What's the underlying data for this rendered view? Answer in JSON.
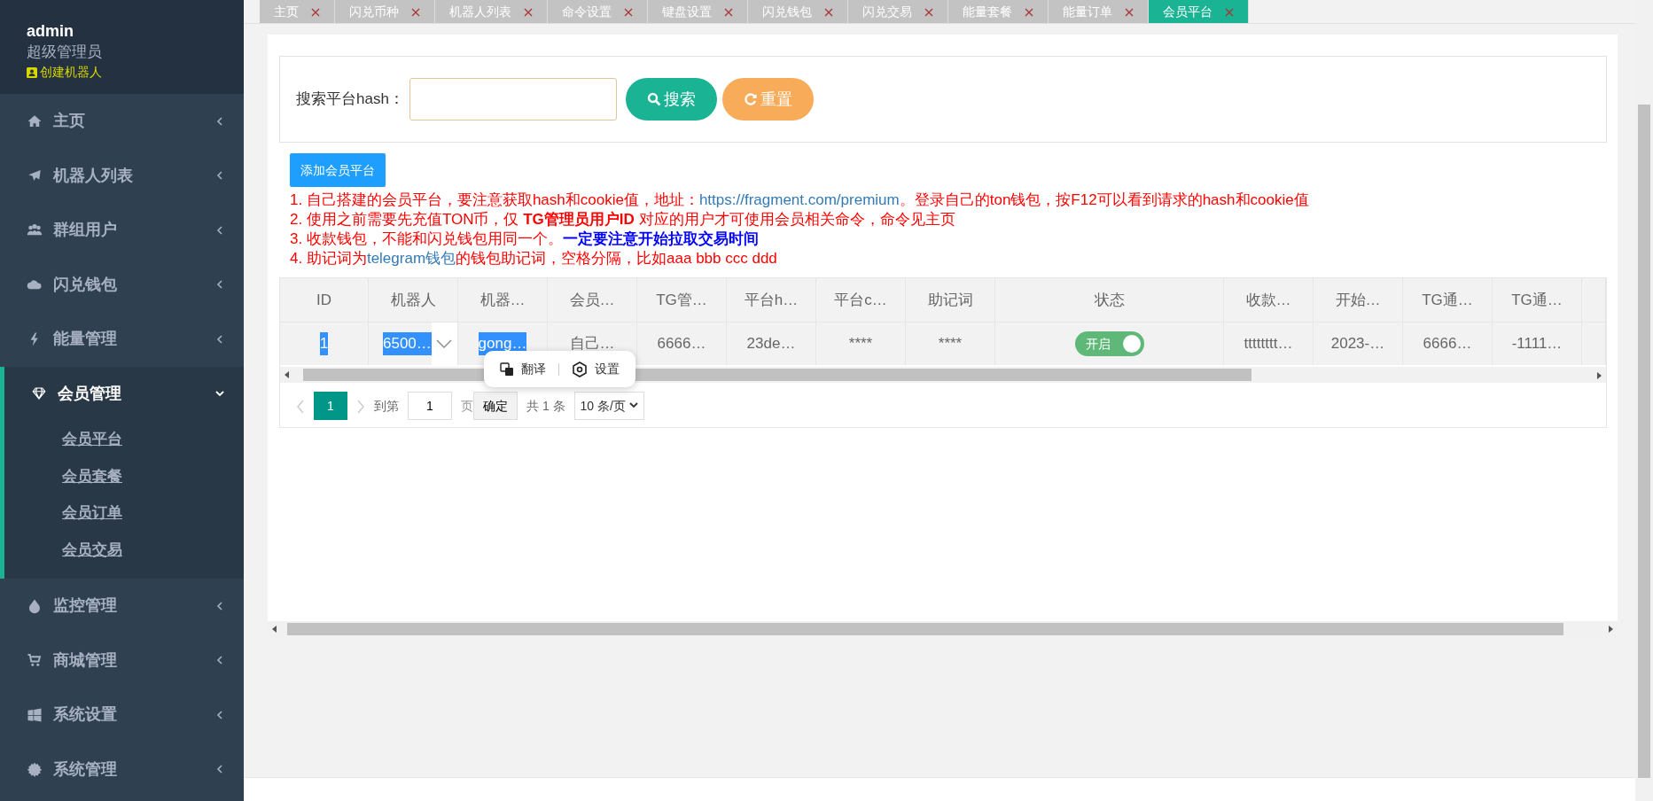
{
  "sidebar": {
    "user": {
      "name": "admin",
      "role": "超级管理员",
      "action": "创建机器人"
    },
    "items": [
      {
        "label": "主页",
        "expanded": false,
        "selected": false
      },
      {
        "label": "机器人列表",
        "expanded": false,
        "selected": false
      },
      {
        "label": "群组用户",
        "expanded": false,
        "selected": false
      },
      {
        "label": "闪兑钱包",
        "expanded": false,
        "selected": false
      },
      {
        "label": "能量管理",
        "expanded": false,
        "selected": false
      },
      {
        "label": "会员管理",
        "expanded": true,
        "selected": true,
        "children": [
          {
            "label": "会员平台"
          },
          {
            "label": "会员套餐"
          },
          {
            "label": "会员订单"
          },
          {
            "label": "会员交易"
          }
        ]
      },
      {
        "label": "监控管理",
        "expanded": false,
        "selected": false
      },
      {
        "label": "商城管理",
        "expanded": false,
        "selected": false
      },
      {
        "label": "系统设置",
        "expanded": false,
        "selected": false
      },
      {
        "label": "系统管理",
        "expanded": false,
        "selected": false
      }
    ]
  },
  "tabs": [
    {
      "label": "主页",
      "selected": false
    },
    {
      "label": "闪兑币种",
      "selected": false
    },
    {
      "label": "机器人列表",
      "selected": false
    },
    {
      "label": "命令设置",
      "selected": false
    },
    {
      "label": "键盘设置",
      "selected": false
    },
    {
      "label": "闪兑钱包",
      "selected": false
    },
    {
      "label": "闪兑交易",
      "selected": false
    },
    {
      "label": "能量套餐",
      "selected": false
    },
    {
      "label": "能量订单",
      "selected": false
    },
    {
      "label": "会员平台",
      "selected": true
    }
  ],
  "search": {
    "label": "搜索平台hash：",
    "search_button": "搜索",
    "reset_button": "重置"
  },
  "add_button": "添加会员平台",
  "notes": [
    [
      {
        "kind": "text",
        "text": "1. 自己搭建的会员平台，要注意获取hash和cookie值，地址："
      },
      {
        "kind": "link",
        "text": "https://fragment.com/premium"
      },
      {
        "kind": "text",
        "text": "。登录自己的ton钱包，按F12可以看到请求的hash和cookie值"
      }
    ],
    [
      {
        "kind": "text",
        "text": "2. 使用之前需要先充值TON币，仅 **TG管理员用户ID** 对应的用户才可使用会员相关命令，命令见主页"
      }
    ],
    [
      {
        "kind": "text",
        "text": "3. 收款钱包，不能和闪兑钱包用同一个。"
      },
      {
        "kind": "emph",
        "text": "一定要注意开始拉取交易时间"
      }
    ],
    [
      {
        "kind": "text",
        "text": "4. 助记词为"
      },
      {
        "kind": "link",
        "text": "telegram钱包"
      },
      {
        "kind": "text",
        "text": "的钱包助记词，空格分隔，比如aaa bbb ccc ddd"
      }
    ]
  ],
  "table": {
    "columns": [
      "ID",
      "机器人",
      "机器…",
      "会员…",
      "TG管…",
      "平台h…",
      "平台c…",
      "助记词",
      "状态",
      "收款…",
      "开始…",
      "TG通…",
      "TG通…"
    ],
    "rows": [
      {
        "cells": [
          {
            "kind": "text",
            "text": "1",
            "highlighted": true
          },
          {
            "kind": "select",
            "text": "6500…",
            "highlighted": true
          },
          {
            "kind": "text",
            "text": "gong…",
            "highlighted": true
          },
          {
            "kind": "text",
            "text": "自己…",
            "highlighted": false
          },
          {
            "kind": "text",
            "text": "6666…",
            "highlighted": false
          },
          {
            "kind": "text",
            "text": "23de…",
            "highlighted": false
          },
          {
            "kind": "text",
            "text": "****",
            "highlighted": false
          },
          {
            "kind": "text",
            "text": "****",
            "highlighted": false
          },
          {
            "kind": "switch",
            "text": "开启",
            "on": true
          },
          {
            "kind": "text",
            "text": "tttttttt…",
            "highlighted": false
          },
          {
            "kind": "text",
            "text": "2023-…",
            "highlighted": false
          },
          {
            "kind": "text",
            "text": "6666…",
            "highlighted": false
          },
          {
            "kind": "text",
            "text": "-1111…",
            "highlighted": false
          }
        ]
      }
    ]
  },
  "popup": {
    "items": [
      {
        "label": "翻译"
      },
      {
        "label": "设置"
      }
    ]
  },
  "pagination": {
    "pages": [
      {
        "label": "1",
        "selected": true
      }
    ],
    "goto_label": "到第",
    "page_value": "1",
    "page_suffix": "页",
    "confirm": "确定",
    "total": "共 1 条",
    "page_size": "10 条/页"
  }
}
